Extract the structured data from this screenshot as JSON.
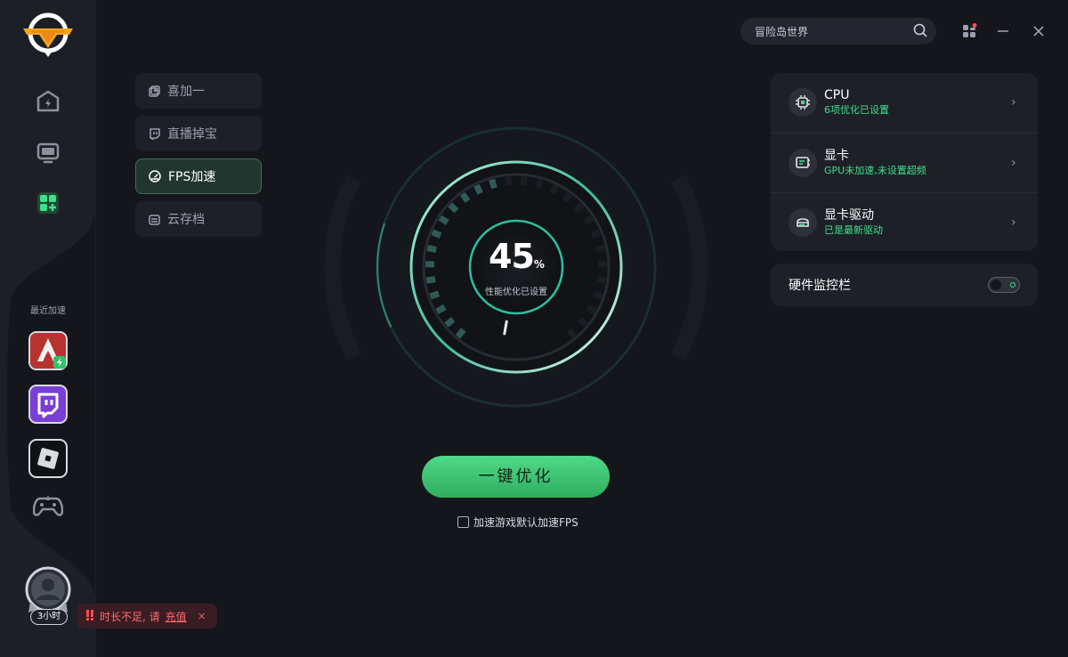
{
  "app": {
    "logo": "logo",
    "colors": {
      "accent": "#3ee08a",
      "button": "#3dc775",
      "warning": "#ff6b6b",
      "background": "#14161c",
      "card": "#1e2028"
    }
  },
  "sidebar": {
    "nav": [
      {
        "icon": "home-icon"
      },
      {
        "icon": "monitor-icon"
      },
      {
        "icon": "apps-grid-icon"
      }
    ],
    "recent_label": "最近加速",
    "recent_games": [
      {
        "icon": "apex-game-icon"
      },
      {
        "icon": "twitch-icon"
      },
      {
        "icon": "roblox-icon"
      },
      {
        "icon": "gamepad-icon"
      }
    ],
    "user": {
      "badge": "3小时"
    }
  },
  "toast": {
    "prefix": "时长不足, 请",
    "link": "充值",
    "close": "×"
  },
  "submenu": [
    {
      "label": "喜加一",
      "icon": "gift-icon",
      "active": false
    },
    {
      "label": "直播掉宝",
      "icon": "live-icon",
      "active": false
    },
    {
      "label": "FPS加速",
      "icon": "speedometer-icon",
      "active": true
    },
    {
      "label": "云存档",
      "icon": "cloud-save-icon",
      "active": false
    }
  ],
  "search": {
    "placeholder": "冒险岛世界"
  },
  "gauge": {
    "value": "45",
    "unit": "%",
    "percent": 45,
    "subtitle": "性能优化已设置"
  },
  "optimize_button": "一键优化",
  "default_fps": {
    "label": "加速游戏默认加速FPS",
    "checked": false
  },
  "panel": {
    "rows": [
      {
        "title": "CPU",
        "subtitle": "6项优化已设置",
        "icon": "cpu-icon",
        "arrow": "›"
      },
      {
        "title": "显卡",
        "subtitle": "GPU未加速,未设置超频",
        "icon": "gpu-icon",
        "arrow": "›"
      },
      {
        "title": "显卡驱动",
        "subtitle": "已是最新驱动",
        "icon": "driver-icon",
        "arrow": "›"
      }
    ]
  },
  "monitor": {
    "label": "硬件监控栏",
    "enabled": false
  }
}
